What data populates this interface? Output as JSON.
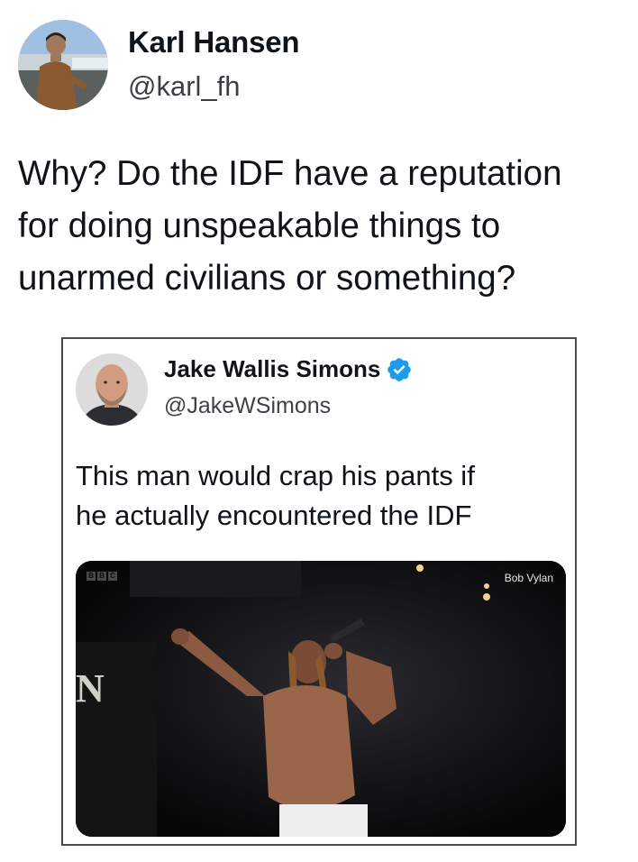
{
  "author": {
    "display_name": "Karl Hansen",
    "handle": "@karl_fh"
  },
  "tweet": {
    "lines": [
      "Why? Do the IDF have a reputation",
      "for doing unspeakable things to",
      "unarmed civilians or something?"
    ]
  },
  "quoted_tweet": {
    "display_name": "Jake Wallis Simons",
    "handle": "@JakeWSimons",
    "verified": true,
    "lines": [
      "This man would crap his pants if",
      "he actually encountered the IDF"
    ],
    "media": {
      "broadcaster_logo": [
        "B",
        "B",
        "C"
      ],
      "caption": "Bob Vylan",
      "stage_text": "N"
    }
  },
  "colors": {
    "verified_blue": "#1d9bf0",
    "text_primary": "#0f1419",
    "text_secondary": "#3a3f44",
    "card_border": "#4a4a4a"
  }
}
